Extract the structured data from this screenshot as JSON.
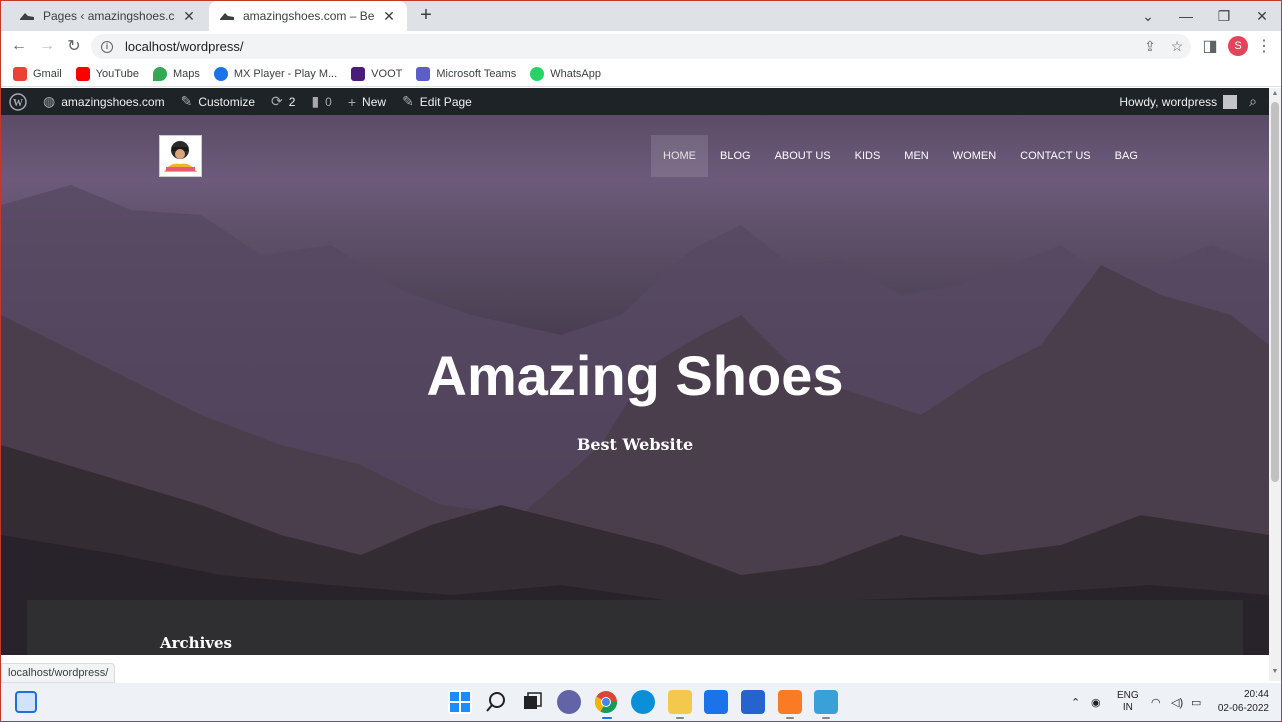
{
  "browser": {
    "tabs": [
      {
        "title": "Pages ‹ amazingshoes.com — W",
        "active": false
      },
      {
        "title": "amazingshoes.com – Best Shoes",
        "active": true
      }
    ],
    "url": "localhost/wordpress/",
    "profile_initial": "S",
    "status_url": "localhost/wordpress/"
  },
  "bookmarks": [
    {
      "label": "Gmail",
      "icon": "gmail-icon",
      "color": "#ea4335"
    },
    {
      "label": "YouTube",
      "icon": "youtube-icon",
      "color": "#ff0000"
    },
    {
      "label": "Maps",
      "icon": "maps-icon",
      "color": "#34a853"
    },
    {
      "label": "MX Player - Play M...",
      "icon": "mx-player-icon",
      "color": "#1a73e8"
    },
    {
      "label": "VOOT",
      "icon": "voot-icon",
      "color": "#4b1d7a"
    },
    {
      "label": "Microsoft Teams",
      "icon": "teams-icon",
      "color": "#5b5fc7"
    },
    {
      "label": "WhatsApp",
      "icon": "whatsapp-icon",
      "color": "#25d366"
    }
  ],
  "wp_admin": {
    "site_name": "amazingshoes.com",
    "customize": "Customize",
    "updates_count": "2",
    "comments_count": "0",
    "new_label": "New",
    "edit_page": "Edit Page",
    "howdy": "Howdy, wordpress"
  },
  "site": {
    "nav": [
      "HOME",
      "BLOG",
      "ABOUT US",
      "KIDS",
      "MEN",
      "WOMEN",
      "CONTACT US",
      "BAG"
    ],
    "hero_title": "Amazing Shoes",
    "hero_subtitle": "Best Website",
    "archives_heading": "Archives"
  },
  "taskbar": {
    "lang_top": "ENG",
    "lang_bottom": "IN",
    "time": "20:44",
    "date": "02-06-2022"
  },
  "colors": {
    "wp_bar": "#1d2327",
    "accent_profile": "#e2445c"
  }
}
